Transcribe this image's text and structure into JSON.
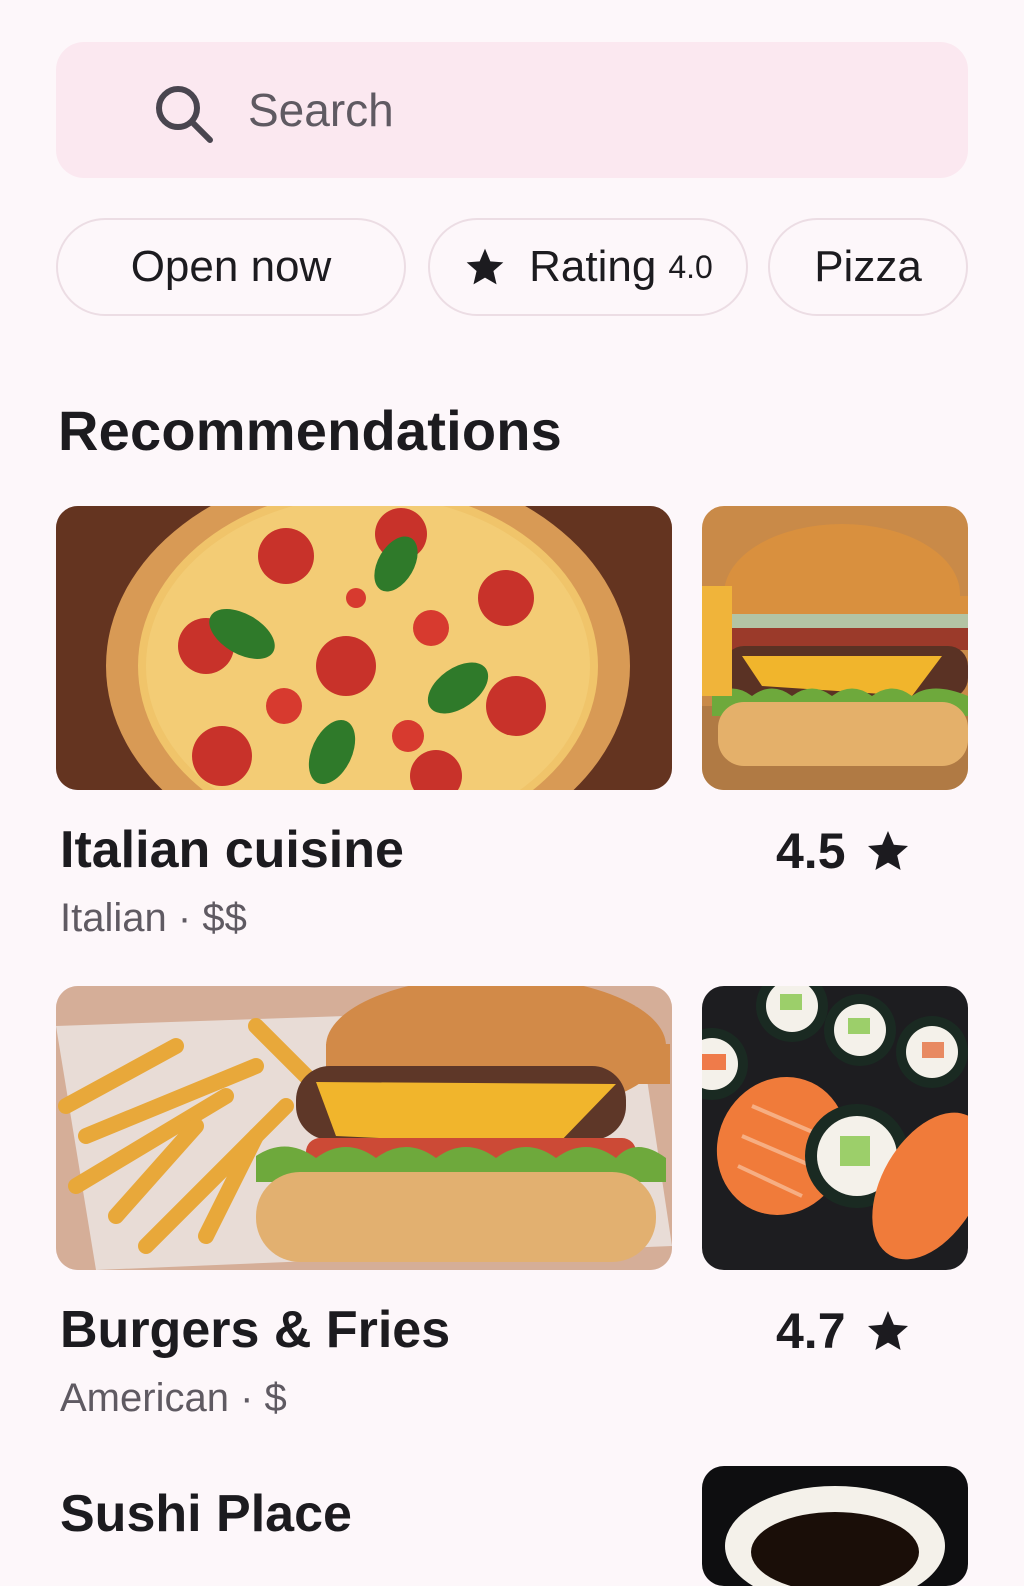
{
  "search": {
    "placeholder": "Search"
  },
  "chips": {
    "open_now": "Open now",
    "rating_label": "Rating",
    "rating_value": "4.0",
    "pizza": "Pizza"
  },
  "section_title": "Recommendations",
  "restaurants": [
    {
      "name": "Italian cuisine",
      "cuisine": "Italian",
      "price": "$$",
      "rating": "4.5"
    },
    {
      "name": "Burgers & Fries",
      "cuisine": "American",
      "price": "$",
      "rating": "4.7"
    },
    {
      "name": "Sushi Place"
    }
  ],
  "separator": "·",
  "colors": {
    "background": "#fdf7fa",
    "search_bg": "#fbe8f0",
    "chip_border": "#ecdde4",
    "text": "#1c1b1f",
    "muted": "#5f5a62"
  },
  "icons": {
    "search": "search-icon",
    "star": "star-icon"
  }
}
